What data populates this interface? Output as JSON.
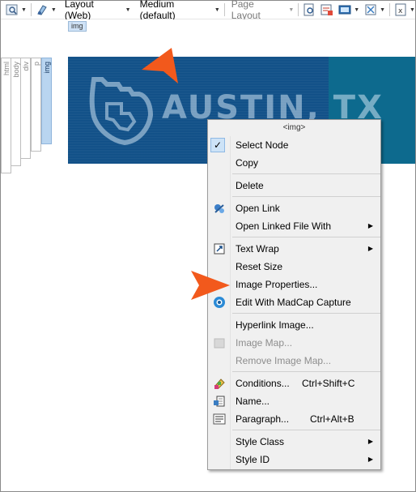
{
  "toolbar": {
    "layout": "Layout (Web)",
    "medium": "Medium (default)",
    "page_layout": "Page Layout",
    "caret": "▼"
  },
  "structure": {
    "selected_tag": "img",
    "breadcrumb": [
      "html",
      "body",
      "div",
      "p",
      "img"
    ]
  },
  "banner": {
    "text": "AUSTIN, TX"
  },
  "context_menu": {
    "header": "<img>",
    "items": [
      {
        "label": "Select Node",
        "checked": true
      },
      {
        "label": "Copy"
      },
      {
        "label": "Delete"
      },
      {
        "label": "Open Link",
        "icon": "open-link-icon"
      },
      {
        "label": "Open Linked File With",
        "submenu": true
      },
      {
        "label": "Text Wrap",
        "icon": "text-wrap-icon",
        "submenu": true
      },
      {
        "label": "Reset Size"
      },
      {
        "label": "Image Properties..."
      },
      {
        "label": "Edit With MadCap Capture",
        "icon": "madcap-capture-icon"
      },
      {
        "label": "Hyperlink Image..."
      },
      {
        "label": "Image Map...",
        "disabled": true,
        "icon": "image-map-icon"
      },
      {
        "label": "Remove Image Map...",
        "disabled": true
      },
      {
        "label": "Conditions...",
        "shortcut": "Ctrl+Shift+C",
        "icon": "conditions-icon"
      },
      {
        "label": "Name...",
        "icon": "name-icon"
      },
      {
        "label": "Paragraph...",
        "shortcut": "Ctrl+Alt+B",
        "icon": "paragraph-icon"
      },
      {
        "label": "Style Class",
        "submenu": true
      },
      {
        "label": "Style ID",
        "submenu": true
      }
    ],
    "check_mark": "✓",
    "submenu_arrow": "▶"
  },
  "colors": {
    "pointer": "#f2591c",
    "banner": "#0d6a8e",
    "selection": "#0d4d86"
  }
}
